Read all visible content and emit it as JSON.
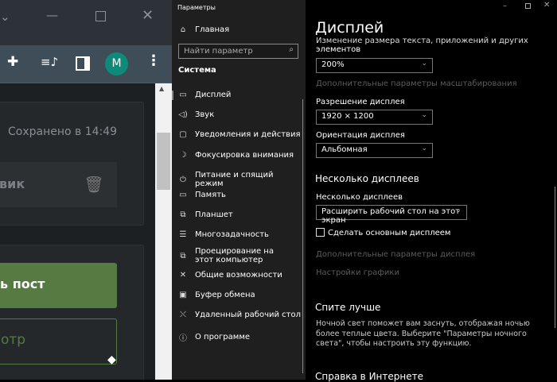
{
  "browser": {
    "avatar_letter": "M",
    "saved_text": "Сохранено в 14:49",
    "draft_button_fragment": "вик",
    "publish_button_fragment": "ь пост",
    "preview_button_fragment": "отр",
    "accent": "#557a42",
    "avatar_color": "#0e8a7a"
  },
  "settings": {
    "window_title": "Параметры",
    "home": "Главная",
    "search_placeholder": "Найти параметр",
    "section": "Система",
    "items": [
      {
        "label": "Дисплей",
        "icon": "monitor-icon"
      },
      {
        "label": "Звук",
        "icon": "speaker-icon"
      },
      {
        "label": "Уведомления и действия",
        "icon": "notification-icon"
      },
      {
        "label": "Фокусировка внимания",
        "icon": "moon-icon"
      },
      {
        "label": "Питание и спящий режим",
        "icon": "power-icon"
      },
      {
        "label": "Память",
        "icon": "storage-icon"
      },
      {
        "label": "Планшет",
        "icon": "tablet-icon"
      },
      {
        "label": "Многозадачность",
        "icon": "multitask-icon"
      },
      {
        "label": "Проецирование на этот компьютер",
        "icon": "project-icon"
      },
      {
        "label": "Общие возможности",
        "icon": "shared-icon"
      },
      {
        "label": "Буфер обмена",
        "icon": "clipboard-icon"
      },
      {
        "label": "Удаленный рабочий стол",
        "icon": "remote-icon"
      },
      {
        "label": "О программе",
        "icon": "info-icon"
      }
    ]
  },
  "display": {
    "title": "Дисплей",
    "scale_label_cut": "Изменение размера текста, приложений и других",
    "scale_label_end": "элементов",
    "scale_value": "200%",
    "advanced_scaling": "Дополнительные параметры масштабирования",
    "resolution_label": "Разрешение дисплея",
    "resolution_value": "1920 × 1200",
    "orientation_label": "Ориентация дисплея",
    "orientation_value": "Альбомная",
    "multi_heading": "Несколько дисплеев",
    "multi_label": "Несколько дисплеев",
    "multi_value": "Расширить рабочий стол на этот экран",
    "make_main": "Сделать основным дисплеем",
    "make_main_checked": false,
    "advanced_display": "Дополнительные параметры дисплея",
    "graphics": "Настройки графики",
    "sleep_heading": "Спите лучше",
    "sleep_text": "Ночной свет поможет вам заснуть, отображая ночью более теплые цвета. Выберите \"Параметры ночного света\", чтобы настроить эту функцию.",
    "help_heading": "Справка в Интернете"
  }
}
